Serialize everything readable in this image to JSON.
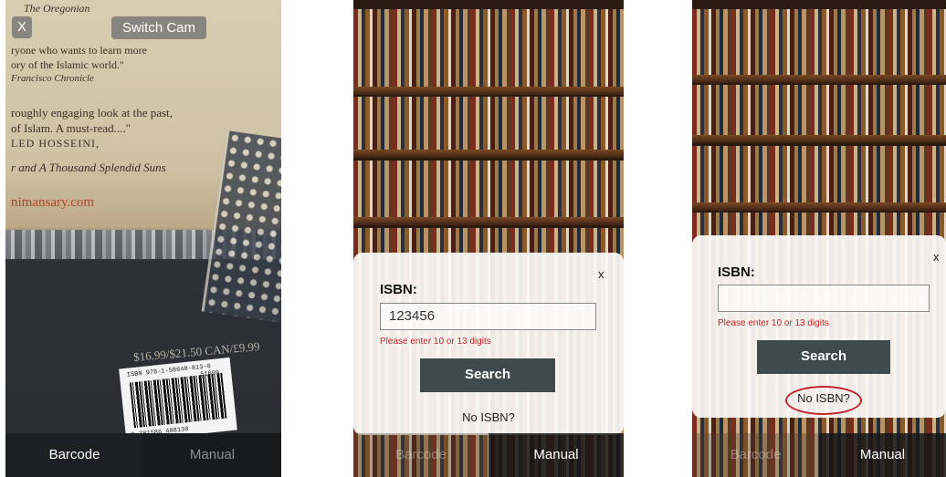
{
  "screen1": {
    "close_label": "X",
    "switch_cam_label": "Switch Cam",
    "book_lines": [
      "The Oregonian",
      "ryone who wants to learn more",
      "ory of the Islamic world.\"",
      "Francisco Chronicle",
      "roughly engaging look at the past,",
      "of Islam. A must-read....\"",
      "LED HOSSEINI,",
      "r and A Thousand Splendid Suns",
      "nimansary.com"
    ],
    "price": "$16.99/$21.50 CAN/£9.99",
    "barcode_isbn": "ISBN 978-1-58648-813-0",
    "barcode_digits": "9 781586 488130",
    "barcode_addon": "51699",
    "tabs": [
      "Barcode",
      "Manual"
    ]
  },
  "screen2": {
    "close_label": "x",
    "isbn_label": "ISBN:",
    "isbn_value": "123456",
    "error_text": "Please enter 10 or 13 digits",
    "search_label": "Search",
    "no_isbn_label": "No ISBN?",
    "tabs": [
      "Barcode",
      "Manual"
    ]
  },
  "screen3": {
    "close_label": "x",
    "isbn_label": "ISBN:",
    "isbn_value": "",
    "error_text": "Please enter 10 or 13 digits",
    "search_label": "Search",
    "no_isbn_label": "No ISBN?",
    "tabs": [
      "Barcode",
      "Manual"
    ]
  },
  "colors": {
    "error": "#cc1f1f",
    "search_button": "#3f4a4c",
    "highlight_circle": "#c4242d"
  }
}
